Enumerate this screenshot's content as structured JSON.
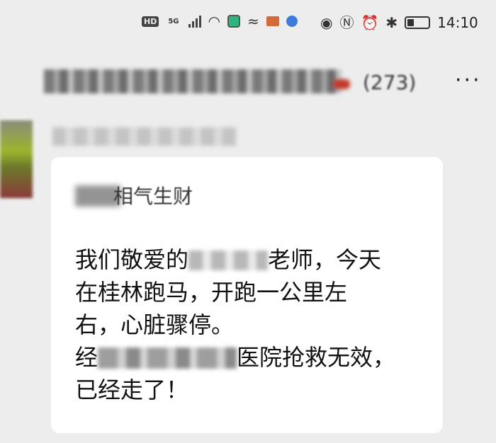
{
  "status_bar": {
    "badge_hd": "HD",
    "badge_5g": "5G",
    "time": "14:10",
    "icons": [
      "signal-icon",
      "wifi-icon",
      "app-icon",
      "app-icon-2",
      "app-icon-3",
      "app-icon-4",
      "eye-icon",
      "nfc-icon",
      "alarm-icon",
      "bluetooth-icon",
      "battery-icon"
    ]
  },
  "header": {
    "count": "(273)",
    "more_label": "···"
  },
  "message": {
    "header_text": "相气生财",
    "lines": [
      {
        "before": "我们敬爱的",
        "after": "老师，今天"
      },
      {
        "text": "在桂林跑马，开跑一公里左"
      },
      {
        "text": "右，心脏骤停。"
      },
      {
        "before": "经",
        "after": "医院抢救无效，"
      },
      {
        "text": "已经走了！"
      }
    ]
  }
}
